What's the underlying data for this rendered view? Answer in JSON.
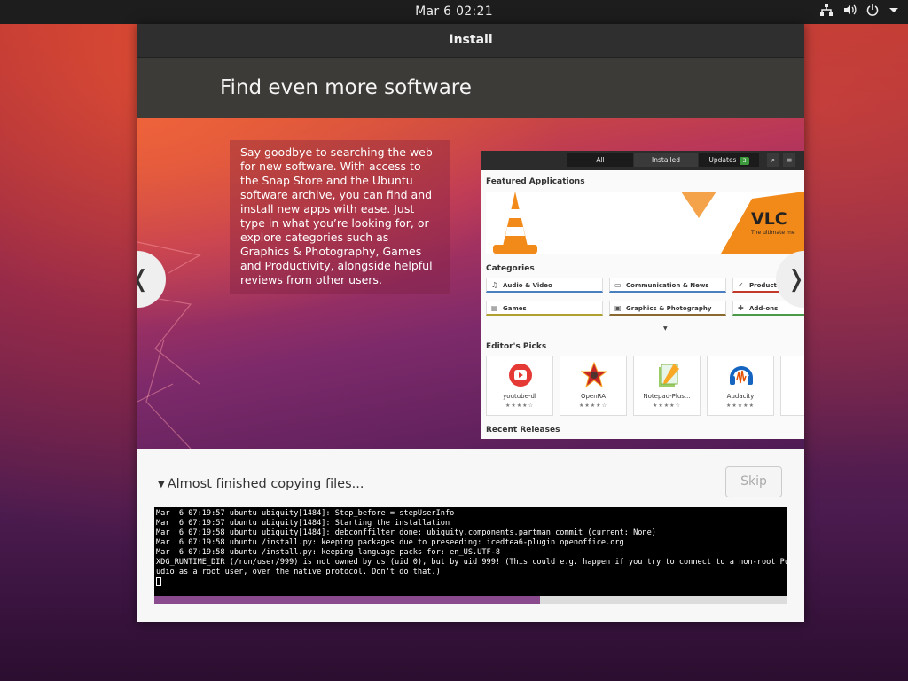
{
  "topbar": {
    "clock": "Mar 6  02:21",
    "icons": [
      "network-icon",
      "volume-icon",
      "power-icon",
      "menu-arrow-icon"
    ]
  },
  "window": {
    "title": "Install",
    "slide_title": "Find even more software",
    "slide_text": "Say goodbye to searching the web for new software. With access to the Snap Store and the Ubuntu software archive, you can find and install new apps with ease. Just type in what you’re looking for, or explore categories such as Graphics & Photography, Games and Productivity, alongside helpful reviews from other users.",
    "screenshot": {
      "tabs": [
        "All",
        "Installed",
        "Updates"
      ],
      "updates_badge": "3",
      "featured_heading": "Featured Applications",
      "banner_title": "VLC",
      "banner_subtitle": "The ultimate me",
      "categories_heading": "Categories",
      "categories": [
        "Audio & Video",
        "Communication & News",
        "Producti",
        "Games",
        "Graphics & Photography",
        "Add-ons"
      ],
      "editors_heading": "Editor's Picks",
      "picks": [
        {
          "name": "youtube-dl",
          "stars": "★★★★☆"
        },
        {
          "name": "OpenRA",
          "stars": "★★★★☆"
        },
        {
          "name": "Notepad-Plus...",
          "stars": "★★★★☆"
        },
        {
          "name": "Audacity",
          "stars": "★★★★★"
        }
      ],
      "recent_heading": "Recent Releases"
    },
    "prev_label": "❬",
    "next_label": "❭",
    "status_text": "Almost finished copying files...",
    "skip_label": "Skip",
    "log_lines": [
      "Mar  6 07:19:57 ubuntu ubiquity[1484]: Step_before = stepUserInfo",
      "Mar  6 07:19:57 ubuntu ubiquity[1484]: Starting the installation",
      "Mar  6 07:19:58 ubuntu ubiquity[1484]: debconffilter_done: ubiquity.components.partman_commit (current: None)",
      "Mar  6 07:19:58 ubuntu /install.py: keeping packages due to preseeding: icedtea6-plugin openoffice.org",
      "Mar  6 07:19:58 ubuntu /install.py: keeping language packs for: en_US.UTF-8",
      "XDG_RUNTIME_DIR (/run/user/999) is not owned by us (uid 0), but by uid 999! (This could e.g. happen if you try to connect to a non-root PulseA",
      "udio as a root user, over the native protocol. Don't do that.)"
    ],
    "progress_fraction": 0.61,
    "progress_color": "#8a4a8e"
  }
}
